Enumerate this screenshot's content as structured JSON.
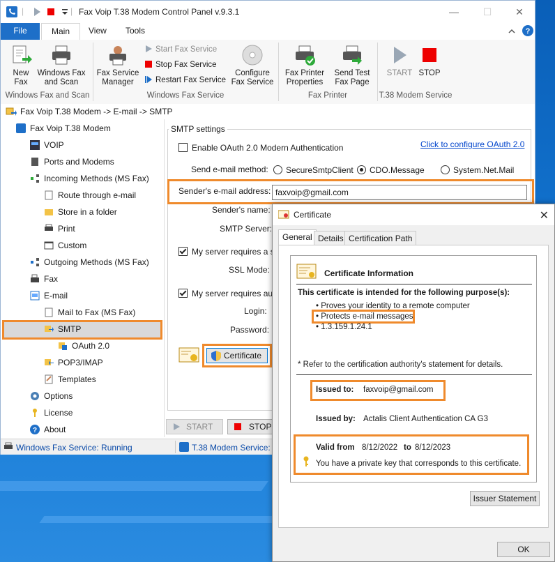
{
  "window": {
    "title": "Fax Voip T.38 Modem Control Panel v.9.3.1",
    "minimize": "—",
    "maximize": "☐",
    "close": "✕"
  },
  "tabs": [
    "File",
    "Main",
    "View",
    "Tools"
  ],
  "ribbon": {
    "new_fax": "New Fax",
    "windows_fax_scan": "Windows Fax and Scan",
    "fax_service_manager": "Fax Service Manager",
    "start_fax_service": "Start Fax Service",
    "stop_fax_service": "Stop Fax Service",
    "restart_fax_service": "Restart Fax Service",
    "configure_fax_service": "Configure Fax Service",
    "fax_printer_properties": "Fax Printer Properties",
    "send_test_fax_page": "Send Test Fax Page",
    "start": "START",
    "stop": "STOP",
    "groups": [
      "Windows Fax and Scan",
      "Windows Fax Service",
      "Fax Printer",
      "T.38 Modem Service"
    ]
  },
  "breadcrumb": "Fax Voip T.38 Modem -> E-mail -> SMTP",
  "tree": [
    "Fax Voip T.38 Modem",
    "VOIP",
    "Ports and Modems",
    "Incoming Methods (MS Fax)",
    "Route through e-mail",
    "Store in a folder",
    "Print",
    "Custom",
    "Outgoing Methods (MS Fax)",
    "Fax",
    "E-mail",
    "Mail to Fax (MS Fax)",
    "SMTP",
    "OAuth 2.0",
    "POP3/IMAP",
    "Templates",
    "Options",
    "License",
    "About"
  ],
  "smtp": {
    "group_title": "SMTP settings",
    "oauth_label": "Enable OAuth 2.0 Modern Authentication",
    "oauth_link": "Click to configure OAuth 2.0",
    "send_method_label": "Send e-mail method:",
    "method_options": [
      "SecureSmtpClient",
      "CDO.Message",
      "System.Net.Mail"
    ],
    "sender_email_label": "Sender's e-mail address:",
    "sender_email_value": "faxvoip@gmail.com",
    "sender_name_label": "Sender's name:",
    "smtp_server_label": "SMTP Server:",
    "secure_label": "My server requires a se",
    "ssl_mode_label": "SSL Mode:",
    "auth_label": "My server requires auth",
    "login_label": "Login:",
    "password_label": "Password:",
    "certificate_button": "Certificate",
    "start_button": "START",
    "stop_button": "STOP"
  },
  "status": {
    "windows_fax": "Windows Fax Service: Running",
    "t38": "T.38 Modem Service: R"
  },
  "certificate": {
    "title": "Certificate",
    "tabs": [
      "General",
      "Details",
      "Certification Path"
    ],
    "info_heading": "Certificate Information",
    "purpose_heading": "This certificate is intended for the following purpose(s):",
    "purposes": [
      "• Proves your identity to a remote computer",
      "• Protects e-mail messages",
      "• 1.3.159.1.24.1"
    ],
    "note": "* Refer to the certification authority's statement for details.",
    "issued_to_label": "Issued to:",
    "issued_to_value": "faxvoip@gmail.com",
    "issued_by_label": "Issued by:",
    "issued_by_value": "Actalis Client Authentication CA G3",
    "valid_from_label": "Valid from",
    "valid_from": "8/12/2022",
    "to_label": "to",
    "valid_to": "8/12/2023",
    "private_key_note": "You have a private key that corresponds to this certificate.",
    "issuer_statement_button": "Issuer Statement",
    "ok_button": "OK"
  },
  "colors": {
    "accent": "#1e6fc8",
    "highlight": "#ef8a2c",
    "link": "#0044cc"
  }
}
